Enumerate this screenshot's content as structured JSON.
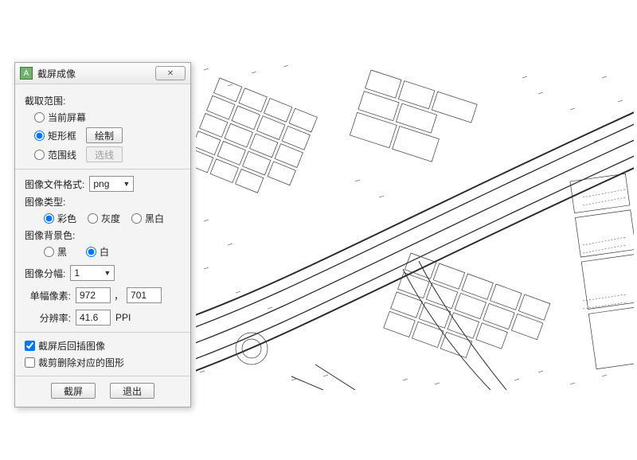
{
  "dialog": {
    "title": "截屏成像",
    "close_glyph": "✕",
    "app_icon_glyph": "A",
    "range": {
      "label": "截取范围:",
      "current_screen": "当前屏幕",
      "rect": "矩形框",
      "draw_btn": "绘制",
      "polyline": "范围线",
      "select_btn": "选线",
      "selected": "rect"
    },
    "format": {
      "label": "图像文件格式:",
      "value": "png"
    },
    "image_type": {
      "label": "图像类型:",
      "color": "彩色",
      "gray": "灰度",
      "bw": "黑白",
      "selected": "color"
    },
    "bg_color": {
      "label": "图像背景色:",
      "black": "黑",
      "white": "白",
      "selected": "white"
    },
    "tiles": {
      "label": "图像分幅:",
      "value": "1"
    },
    "pixels": {
      "label": "单幅像素:",
      "w": "972",
      "sep": "，",
      "h": "701"
    },
    "dpi": {
      "label": "分辨率:",
      "value": "41.6",
      "unit": "PPI"
    },
    "options": {
      "insert_after": "截屏后回插图像",
      "insert_after_checked": true,
      "crop_delete": "裁剪删除对应的图形",
      "crop_delete_checked": false
    },
    "footer": {
      "capture": "截屏",
      "exit": "退出"
    }
  }
}
